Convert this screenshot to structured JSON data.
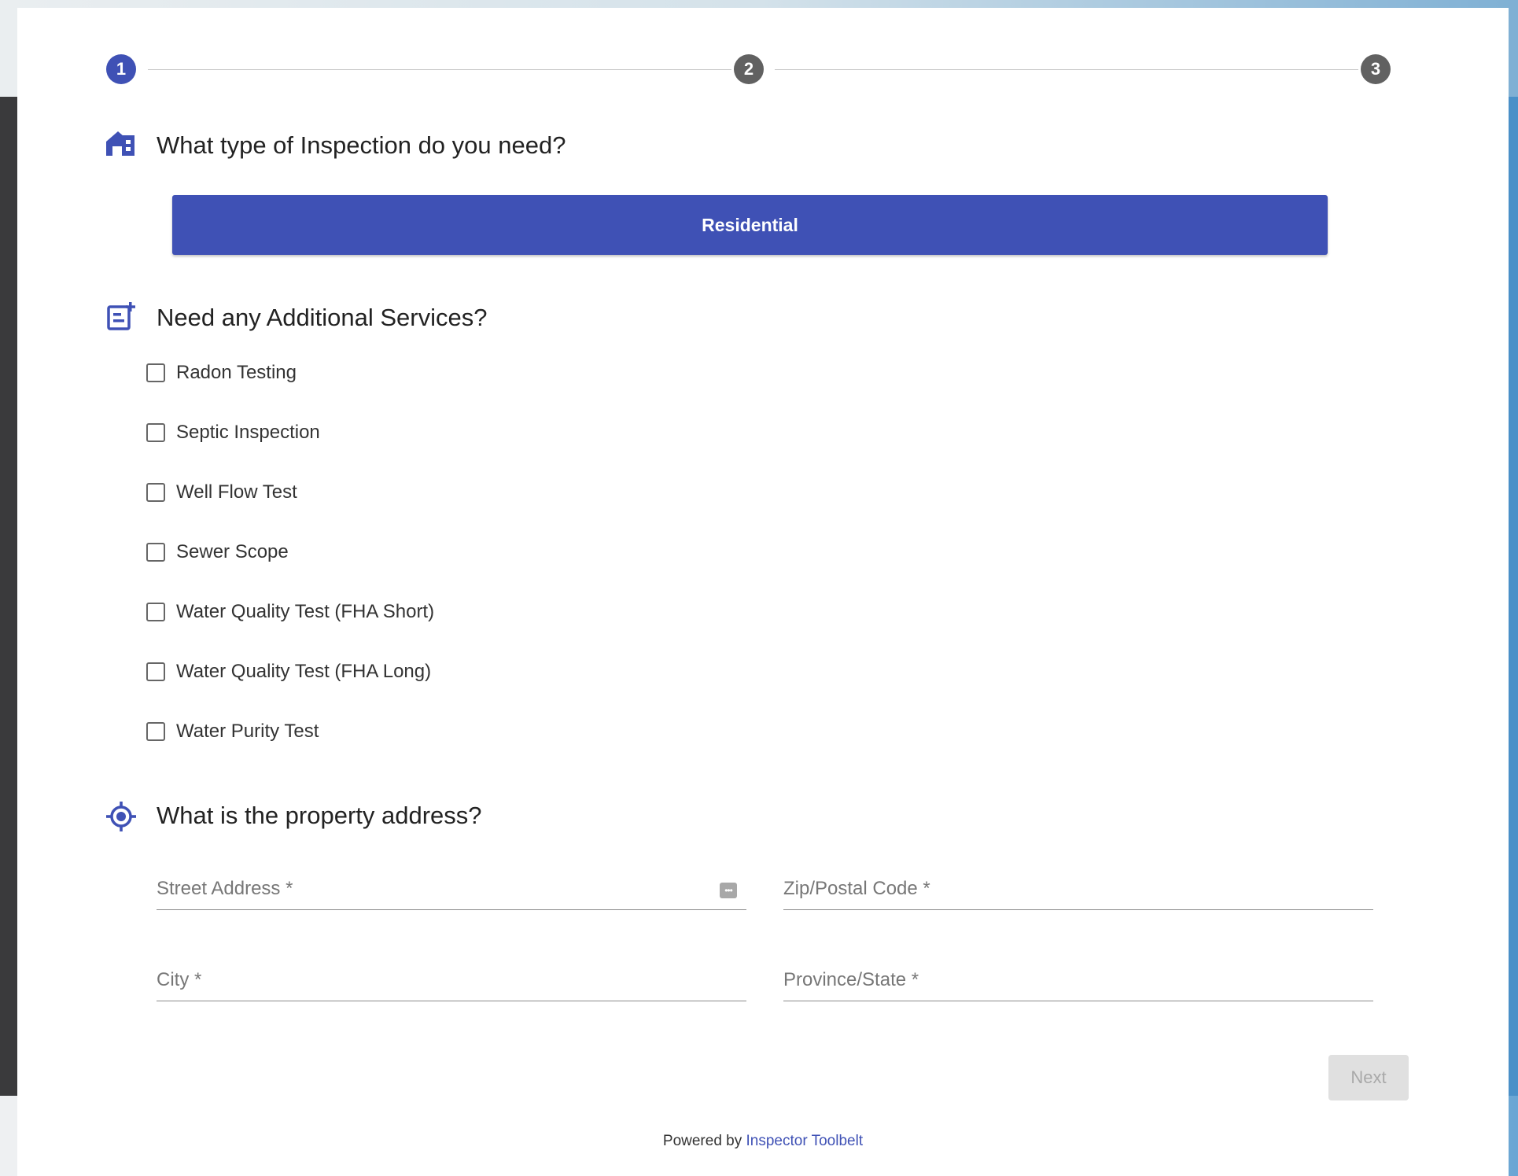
{
  "stepper": {
    "steps": [
      "1",
      "2",
      "3"
    ],
    "active_step": 1
  },
  "inspection": {
    "title": "What type of Inspection do you need?",
    "icon": "house-icon",
    "selected_option": "Residential"
  },
  "services": {
    "title": "Need any Additional Services?",
    "icon": "add-service-icon",
    "items": [
      {
        "label": "Radon Testing",
        "checked": false
      },
      {
        "label": "Septic Inspection",
        "checked": false
      },
      {
        "label": "Well Flow Test",
        "checked": false
      },
      {
        "label": "Sewer Scope",
        "checked": false
      },
      {
        "label": "Water Quality Test (FHA Short)",
        "checked": false
      },
      {
        "label": "Water Quality Test (FHA Long)",
        "checked": false
      },
      {
        "label": "Water Purity Test",
        "checked": false
      }
    ]
  },
  "address": {
    "title": "What is the property address?",
    "icon": "location-target-icon",
    "street_placeholder": "Street Address *",
    "zip_placeholder": "Zip/Postal Code *",
    "city_placeholder": "City *",
    "state_placeholder": "Province/State *"
  },
  "actions": {
    "next_label": "Next",
    "next_enabled": false
  },
  "footer": {
    "prefix": "Powered by",
    "link_text": "Inspector Toolbelt"
  },
  "colors": {
    "primary": "#3f51b5",
    "step_inactive": "#616161"
  }
}
